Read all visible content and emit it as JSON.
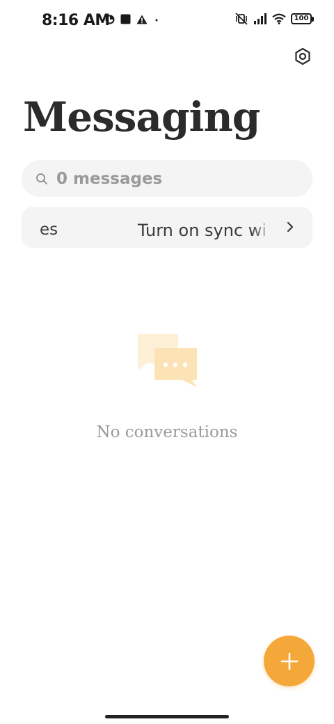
{
  "status_bar": {
    "time": "8:16 AM",
    "battery": "100",
    "left_icons": [
      "data-saver-icon",
      "square-notification-icon",
      "warning-icon",
      "dot-icon"
    ],
    "right_icons": [
      "muted-vibrate-icon",
      "signal-icon",
      "wifi-icon",
      "battery-icon"
    ]
  },
  "header": {
    "title": "Messaging",
    "settings_icon": "gear-icon"
  },
  "search": {
    "placeholder": "0 messages",
    "icon": "search-icon"
  },
  "sync_banner": {
    "fragment": "es",
    "text": "Turn on sync wi",
    "icon": "chevron-right-icon"
  },
  "empty_state": {
    "icon": "chat-bubbles-icon",
    "text": "No conversations"
  },
  "fab": {
    "icon": "plus-icon"
  },
  "colors": {
    "accent": "#f5a83a",
    "surface": "#f4f4f4",
    "title": "#2b2b2b",
    "muted_text": "#9a9a9a",
    "illustration_light": "#fdf0d6",
    "illustration_dark": "#fce3b5"
  }
}
